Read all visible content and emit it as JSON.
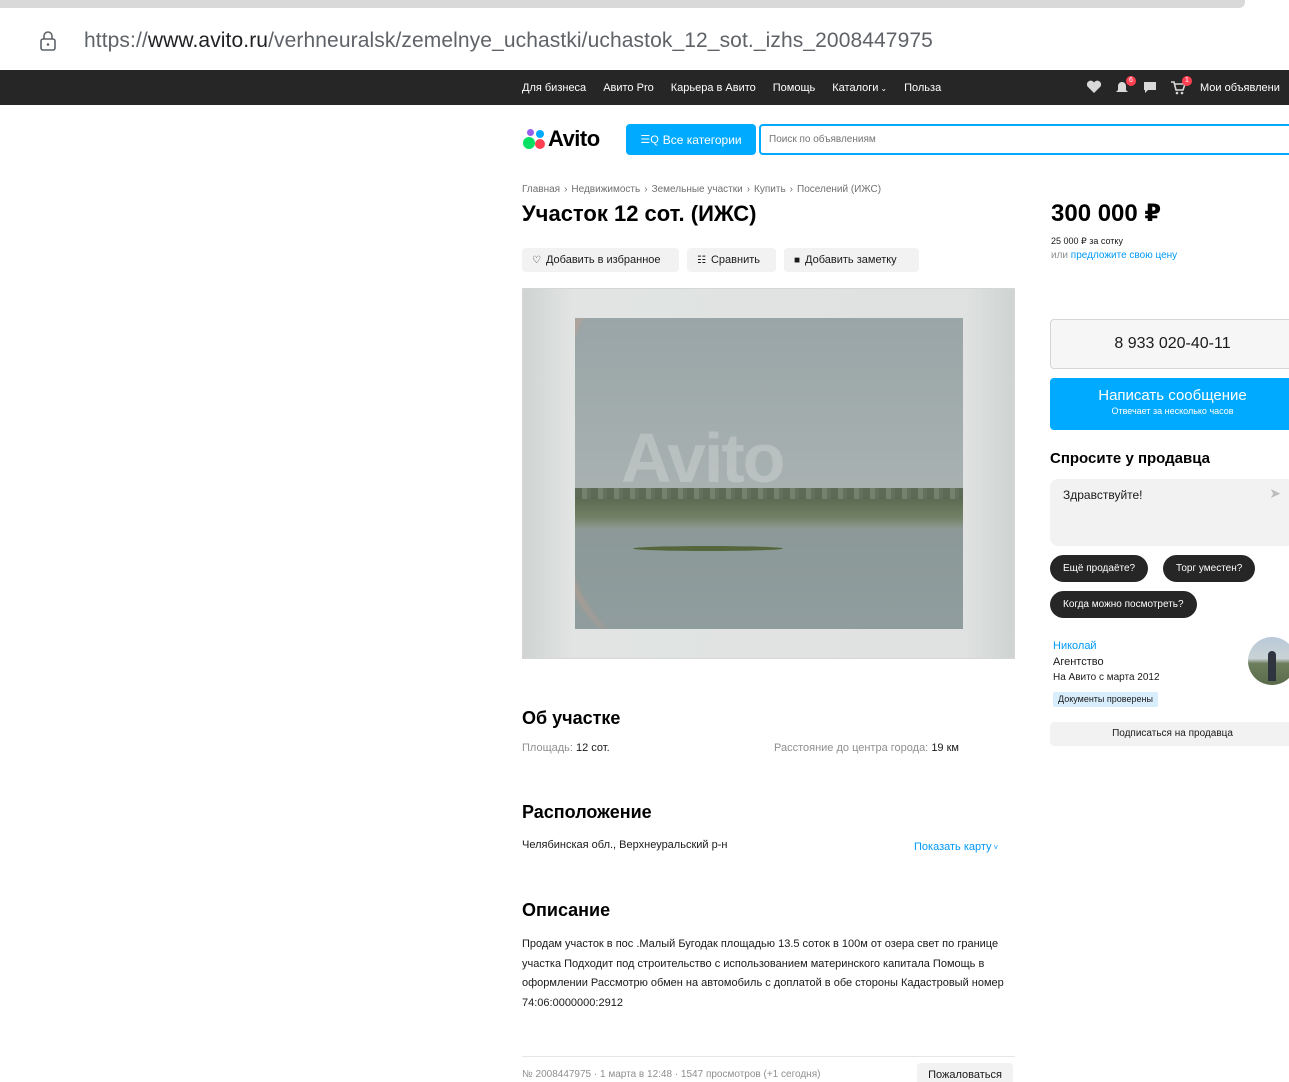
{
  "browser": {
    "url_prefix": "https://",
    "url_domain": "www.avito.ru",
    "url_path": "/verhneuralsk/zemelnye_uchastki/uchastok_12_sot._izhs_2008447975"
  },
  "topnav": {
    "links": [
      "Для бизнеса",
      "Авито Pro",
      "Карьера в Авито",
      "Помощь",
      "Каталоги",
      "Польза"
    ],
    "notifications_badge": "6",
    "cart_badge": "1",
    "my_ads": "Мои объявлени"
  },
  "header": {
    "logo": "Avito",
    "categories_button": "Все категории",
    "search_placeholder": "Поиск по объявлениям"
  },
  "breadcrumb": [
    "Главная",
    "Недвижимость",
    "Земельные участки",
    "Купить",
    "Поселений (ИЖС)"
  ],
  "listing": {
    "title": "Участок 12 сот. (ИЖС)",
    "actions": {
      "favorite": "Добавить в избранное",
      "compare": "Сравнить",
      "note": "Добавить заметку"
    },
    "photo_watermark": "Avito"
  },
  "about": {
    "heading": "Об участке",
    "area_label": "Площадь:",
    "area_value": "12 сот.",
    "distance_label": "Расстояние до центра города:",
    "distance_value": "19 км"
  },
  "location": {
    "heading": "Расположение",
    "address": "Челябинская обл., Верхнеуральский р-н",
    "show_map": "Показать карту"
  },
  "description": {
    "heading": "Описание",
    "text": "Продам участок в пос .Малый Бугодак площадью 13.5 соток в 100м от озера свет по границе участка Подходит под строительство с использованием материнского капитала Помощь в оформлении Рассмотрю обмен на автомобиль с доплатой в обе стороны Кадастровый номер 74:06:0000000:2912"
  },
  "footer": {
    "meta": "№ 2008447975 · 1 марта в 12:48 · 1547 просмотров (+1 сегодня)",
    "report": "Пожаловаться"
  },
  "sidebar": {
    "price": "300 000 ₽",
    "price_per": "25 000 ₽ за сотку",
    "offer_prefix": "или",
    "offer_link": "предложите свою цену",
    "phone": "8 933 020-40-11",
    "message_button": "Написать сообщение",
    "message_sub": "Отвечает за несколько часов",
    "ask_heading": "Спросите у продавца",
    "ask_text": "Здравствуйте!",
    "quick_replies": [
      "Ещё продаёте?",
      "Торг уместен?",
      "Когда можно посмотреть?"
    ],
    "seller_name": "Николай",
    "seller_type": "Агентство",
    "seller_since": "На Авито с марта 2012",
    "verified": "Документы проверены",
    "subscribe": "Подписаться на продавца"
  },
  "colors": {
    "accent": "#00aaff",
    "nav_bg": "#262626",
    "link": "#0099f7"
  }
}
